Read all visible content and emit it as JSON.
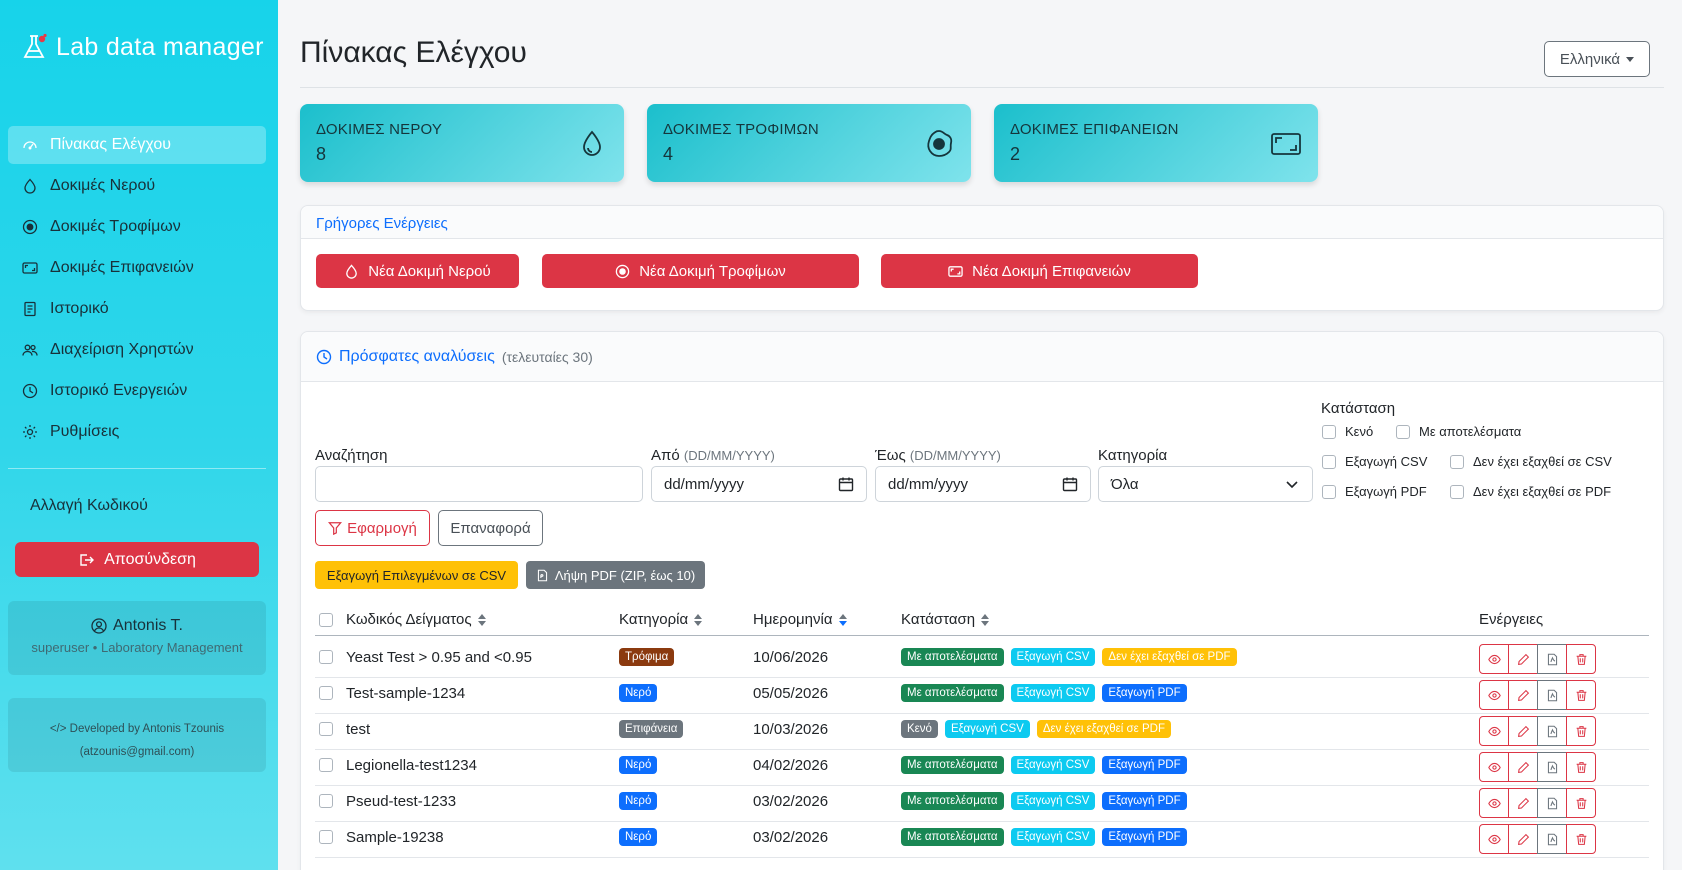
{
  "app": {
    "brand": "Lab data manager",
    "accent": "#dc3545",
    "sidebar_gradient": [
      "#17d3ea",
      "#5fe0ee"
    ]
  },
  "sidebar": {
    "items": [
      {
        "label": "Πίνακας Ελέγχου",
        "icon": "speedometer-icon",
        "active": true
      },
      {
        "label": "Δοκιμές Νερού",
        "icon": "droplet-icon"
      },
      {
        "label": "Δοκιμές Τροφίμων",
        "icon": "record-circle-icon"
      },
      {
        "label": "Δοκιμές Επιφανειών",
        "icon": "aspect-ratio-icon"
      },
      {
        "label": "Ιστορικό",
        "icon": "journal-icon"
      },
      {
        "label": "Διαχείριση Χρηστών",
        "icon": "people-icon"
      },
      {
        "label": "Ιστορικό Ενεργειών",
        "icon": "clock-icon"
      },
      {
        "label": "Ρυθμίσεις",
        "icon": "gear-icon"
      }
    ],
    "change_password": "Αλλαγή Κωδικού",
    "logout": "Αποσύνδεση",
    "user": {
      "name": "Antonis T.",
      "role": "superuser • Laboratory Management"
    },
    "dev": {
      "line1": "Developed by Antonis Tzounis",
      "line2": "(atzounis@gmail.com)"
    }
  },
  "header": {
    "title": "Πίνακας Ελέγχου",
    "language": "Ελληνικά"
  },
  "stats": [
    {
      "label": "ΔΟΚΙΜΕΣ ΝΕΡΟΥ",
      "value": "8",
      "icon": "droplet-icon"
    },
    {
      "label": "ΔΟΚΙΜΕΣ ΤΡΟΦΙΜΩΝ",
      "value": "4",
      "icon": "egg-fried-icon"
    },
    {
      "label": "ΔΟΚΙΜΕΣ ΕΠΙΦΑΝΕΙΩΝ",
      "value": "2",
      "icon": "aspect-ratio-icon"
    }
  ],
  "quick_actions": {
    "title": "Γρήγορες Ενέργειες",
    "buttons": [
      {
        "label": "Νέα Δοκιμή Νερού",
        "icon": "droplet-icon"
      },
      {
        "label": "Νέα Δοκιμή Τροφίμων",
        "icon": "record-circle-icon"
      },
      {
        "label": "Νέα Δοκιμή Επιφανειών",
        "icon": "aspect-ratio-icon"
      }
    ]
  },
  "recent": {
    "title": "Πρόσφατες αναλύσεις",
    "subtitle": "(τελευταίες 30)",
    "filters": {
      "search_label": "Αναζήτηση",
      "search_value": "",
      "from_label": "Από",
      "from_hint": "(DD/MM/YYYY)",
      "from_value": "dd/mm/yyyy",
      "to_label": "Έως",
      "to_hint": "(DD/MM/YYYY)",
      "to_value": "dd/mm/yyyy",
      "category_label": "Κατηγορία",
      "category_value": "Όλα",
      "status_label": "Κατάσταση",
      "status_options": [
        "Κενό",
        "Με αποτελέσματα",
        "Εξαγωγή CSV",
        "Δεν έχει εξαχθεί σε CSV",
        "Εξαγωγή PDF",
        "Δεν έχει εξαχθεί σε PDF"
      ],
      "apply": "Εφαρμογή",
      "reset": "Επαναφορά"
    },
    "export_csv": "Εξαγωγή Επιλεγμένων σε CSV",
    "download_pdf": "Λήψη PDF (ZIP, έως 10)",
    "columns": {
      "code": "Κωδικός Δείγματος",
      "category": "Κατηγορία",
      "date": "Ημερομηνία",
      "status": "Κατάσταση",
      "actions": "Ενέργειες"
    },
    "rows": [
      {
        "code": "Yeast Test > 0.95 and <0.95",
        "category": "Τρόφιμα",
        "cat_color": "brown",
        "date": "10/06/2026",
        "badges": [
          {
            "t": "Με αποτελέσματα",
            "c": "green"
          },
          {
            "t": "Εξαγωγή CSV",
            "c": "cyan"
          },
          {
            "t": "Δεν έχει εξαχθεί σε PDF",
            "c": "yellow"
          }
        ]
      },
      {
        "code": "Test-sample-1234",
        "category": "Νερό",
        "cat_color": "blue",
        "date": "05/05/2026",
        "badges": [
          {
            "t": "Με αποτελέσματα",
            "c": "green"
          },
          {
            "t": "Εξαγωγή CSV",
            "c": "cyan"
          },
          {
            "t": "Εξαγωγή PDF",
            "c": "blue"
          }
        ]
      },
      {
        "code": "test",
        "category": "Επιφάνεια",
        "cat_color": "grey",
        "date": "10/03/2026",
        "badges": [
          {
            "t": "Κενό",
            "c": "grey"
          },
          {
            "t": "Εξαγωγή CSV",
            "c": "cyan"
          },
          {
            "t": "Δεν έχει εξαχθεί σε PDF",
            "c": "yellow"
          }
        ]
      },
      {
        "code": "Legionella-test1234",
        "category": "Νερό",
        "cat_color": "blue",
        "date": "04/02/2026",
        "badges": [
          {
            "t": "Με αποτελέσματα",
            "c": "green"
          },
          {
            "t": "Εξαγωγή CSV",
            "c": "cyan"
          },
          {
            "t": "Εξαγωγή PDF",
            "c": "blue"
          }
        ]
      },
      {
        "code": "Pseud-test-1233",
        "category": "Νερό",
        "cat_color": "blue",
        "date": "03/02/2026",
        "badges": [
          {
            "t": "Με αποτελέσματα",
            "c": "green"
          },
          {
            "t": "Εξαγωγή CSV",
            "c": "cyan"
          },
          {
            "t": "Εξαγωγή PDF",
            "c": "blue"
          }
        ]
      },
      {
        "code": "Sample-19238",
        "category": "Νερό",
        "cat_color": "blue",
        "date": "03/02/2026",
        "badges": [
          {
            "t": "Με αποτελέσματα",
            "c": "green"
          },
          {
            "t": "Εξαγωγή CSV",
            "c": "cyan"
          },
          {
            "t": "Εξαγωγή PDF",
            "c": "blue"
          }
        ]
      }
    ]
  }
}
